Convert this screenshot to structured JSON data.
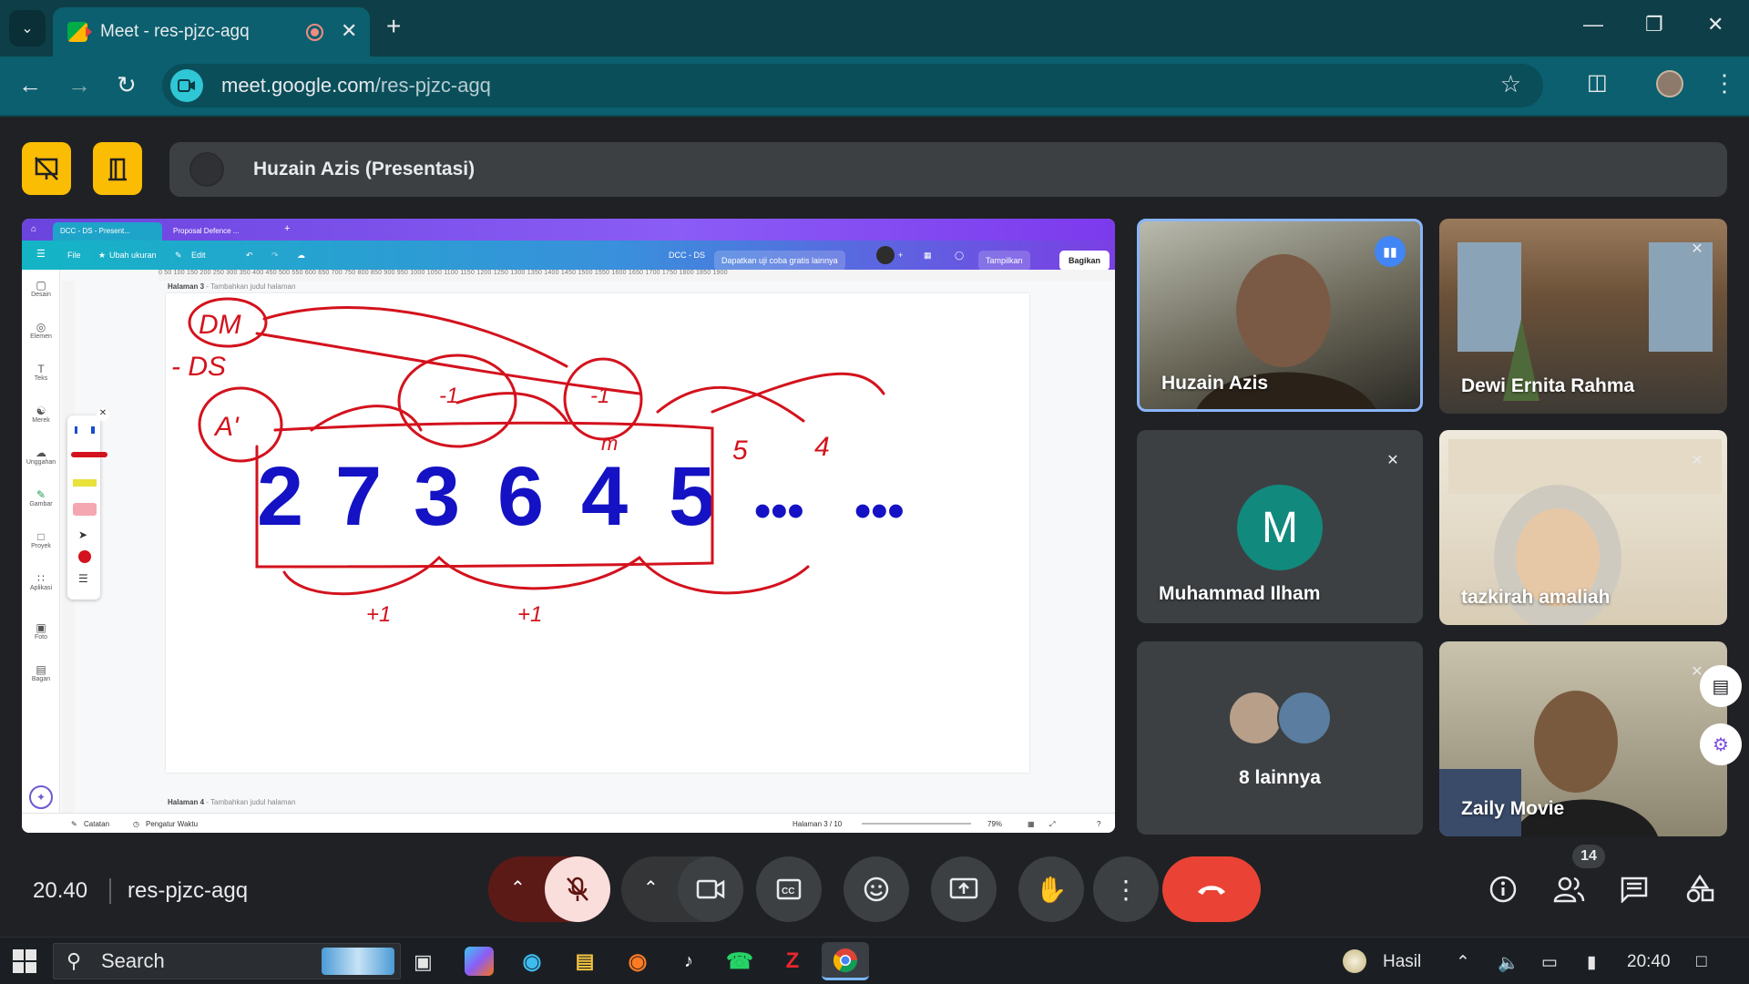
{
  "browser": {
    "tab_title": "Meet - res-pjzc-agq",
    "url_host": "meet.google.com",
    "url_path": "/res-pjzc-agq"
  },
  "meet": {
    "presenter_label": "Huzain Azis (Presentasi)",
    "participants": [
      {
        "name": "Huzain Azis",
        "speaking": true,
        "video": true
      },
      {
        "name": "Dewi Ernita Rahma",
        "muted": true,
        "video": true
      },
      {
        "name": "Muhammad Ilham",
        "muted": true,
        "initial": "M",
        "avatar_color": "#12897d"
      },
      {
        "name": "tazkirah amaliah",
        "muted": true,
        "video": true
      },
      {
        "name": "8 lainnya",
        "group": true
      },
      {
        "name": "Zaily Movie",
        "muted": true,
        "video": true
      }
    ],
    "time": "20.40",
    "meeting_code": "res-pjzc-agq",
    "participant_count": "14"
  },
  "canva": {
    "tabs": [
      "DCC - DS - Present...",
      "Proposal Defence ..."
    ],
    "menu": {
      "file": "File",
      "resize": "Ubah ukuran",
      "edit": "Edit",
      "doc_title": "DCC - DS",
      "trial": "Dapatkan uji coba gratis lainnya",
      "present": "Tampilkan",
      "share": "Bagikan"
    },
    "sidebar": [
      "Desain",
      "Elemen",
      "Teks",
      "Merek",
      "Unggahan",
      "Gambar",
      "Proyek",
      "Aplikasi",
      "Foto",
      "Bagan"
    ],
    "ruler": "0  50  100  150  200  250  300  350  400  450  500  550  600  650  700  750  800  850  900  950  1000  1050  1100  1150  1200  1250  1300  1350  1400  1450  1500  1550  1600  1650  1700  1750  1800  1850  1900",
    "page3_label": "Halaman 3",
    "page3_hint": "- Tambahkan judul halaman",
    "page4_label": "Halaman 4",
    "page4_hint": "- Tambahkan judul halaman",
    "slide_digits": [
      "2",
      "7",
      "3",
      "6",
      "4",
      "5"
    ],
    "slide_dots": [
      "•••",
      "•••"
    ],
    "annotations": {
      "dm": "DM",
      "ds": "- DS",
      "ai": "A'",
      "m1": "-1",
      "m2": "-1",
      "m3": "m",
      "n5": "5",
      "n4": "4",
      "p1": "+1",
      "p2": "+1"
    },
    "bottom": {
      "notes": "Catatan",
      "timer": "Pengatur Waktu",
      "page_of": "Halaman 3 / 10",
      "zoom": "79%"
    }
  },
  "taskbar": {
    "search": "Search",
    "weather": "Hasil",
    "clock": "20:40"
  },
  "colors": {
    "chrome_tab": "#0b5f6e",
    "chrome_top": "#0e3e47",
    "yellow": "#fbbc04",
    "end_call": "#ea4335",
    "ink": "#d3121d",
    "slide_digits": "#1412c4"
  }
}
